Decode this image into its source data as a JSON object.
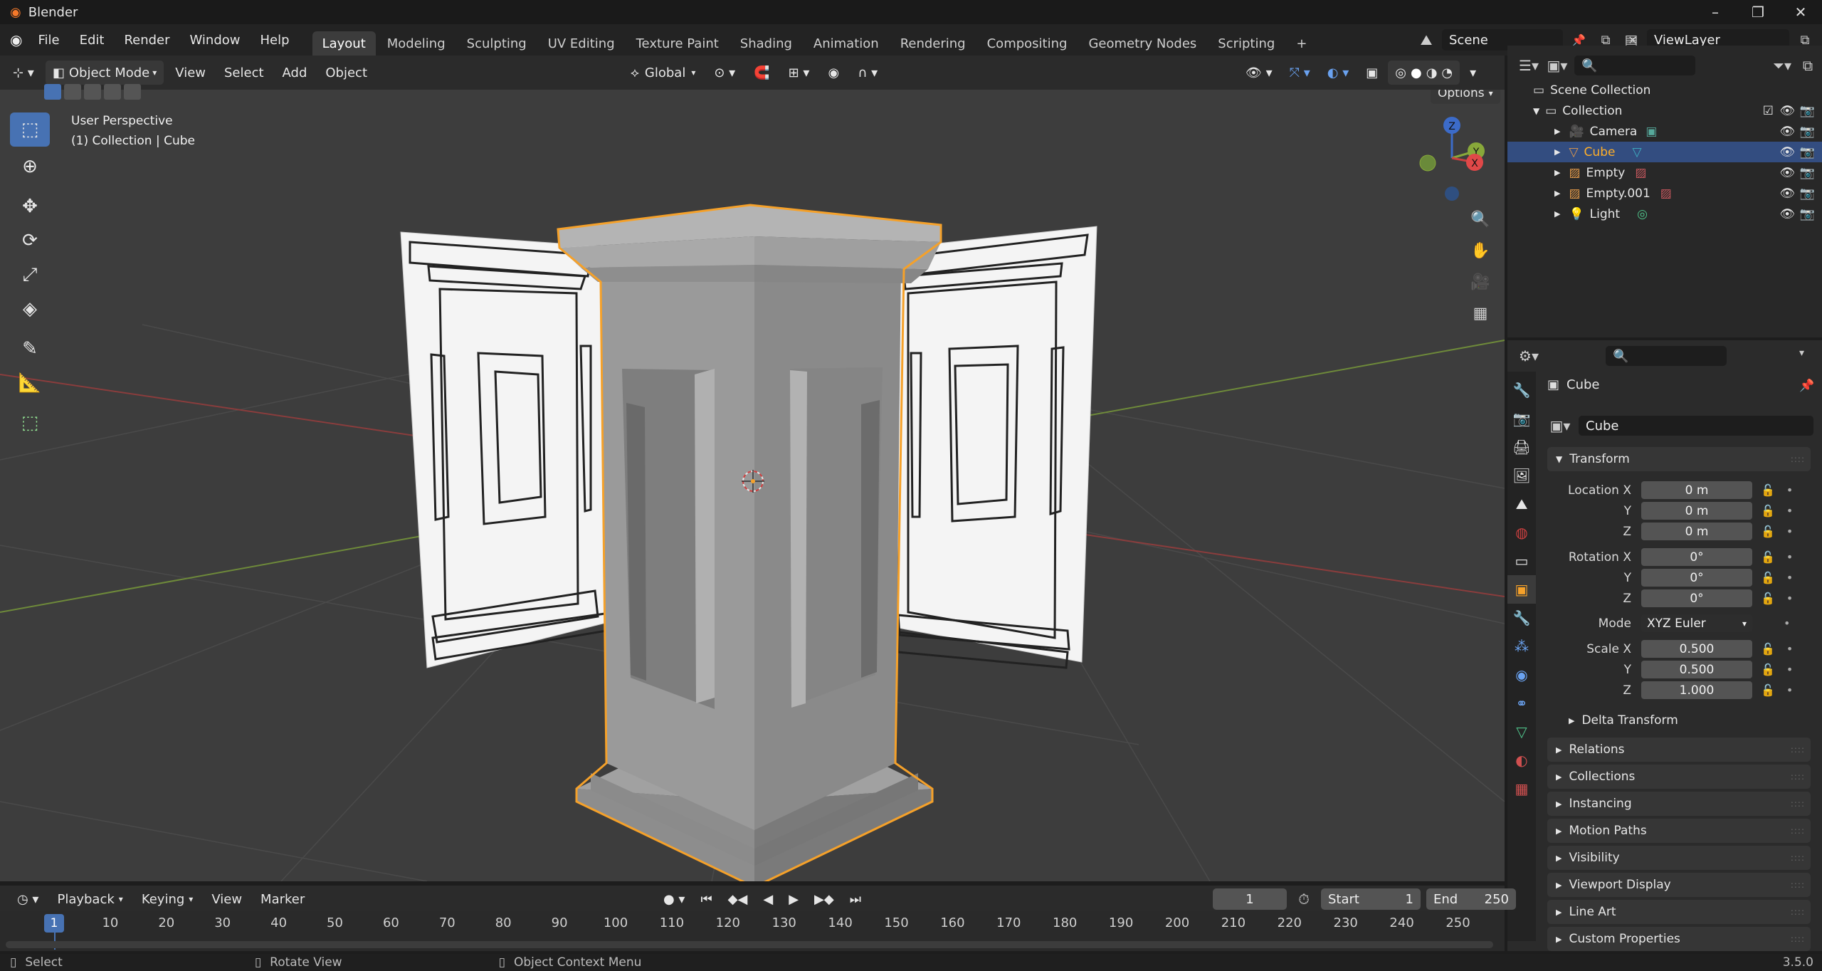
{
  "app": {
    "title": "Blender",
    "version": "3.5.0"
  },
  "window_controls": {
    "minimize": "–",
    "maximize": "❐",
    "close": "✕"
  },
  "menus": [
    "File",
    "Edit",
    "Render",
    "Window",
    "Help"
  ],
  "workspace_tabs": [
    "Layout",
    "Modeling",
    "Sculpting",
    "UV Editing",
    "Texture Paint",
    "Shading",
    "Animation",
    "Rendering",
    "Compositing",
    "Geometry Nodes",
    "Scripting"
  ],
  "workspace_add": "+",
  "scene": {
    "name": "Scene"
  },
  "view_layer": {
    "name": "ViewLayer"
  },
  "viewport_header": {
    "mode": "Object Mode",
    "menus": [
      "View",
      "Select",
      "Add",
      "Object"
    ],
    "orientation": "Global",
    "options": "Options"
  },
  "viewport": {
    "perspective": "User Perspective",
    "collection_info": "(1) Collection | Cube",
    "gizmo": {
      "z": "Z",
      "y": "Y",
      "x": "X"
    }
  },
  "tools": [
    "select-box",
    "cursor",
    "move",
    "rotate",
    "scale",
    "transform",
    "annotate",
    "measure",
    "add-cube"
  ],
  "outliner": {
    "search_placeholder": "",
    "scene_collection": "Scene Collection",
    "collection": "Collection",
    "items": [
      {
        "name": "Camera",
        "icon": "camera-icon",
        "color": "#e39a4a",
        "extra_color": "#56a89a",
        "selected": false
      },
      {
        "name": "Cube",
        "icon": "mesh-icon",
        "color": "#e39a4a",
        "extra_color": "#3fb0c2",
        "selected": true
      },
      {
        "name": "Empty",
        "icon": "empty-image-icon",
        "color": "#e39a4a",
        "extra_color": "#c8585e",
        "selected": false
      },
      {
        "name": "Empty.001",
        "icon": "empty-image-icon",
        "color": "#e39a4a",
        "extra_color": "#c8585e",
        "selected": false
      },
      {
        "name": "Light",
        "icon": "light-icon",
        "color": "#e39a4a",
        "extra_color": "#4fc28a",
        "selected": false
      }
    ]
  },
  "properties": {
    "object_name": "Cube",
    "name_field": "Cube",
    "transform": {
      "title": "Transform",
      "location": {
        "label": "Location X",
        "x": "0 m",
        "y": "0 m",
        "z": "0 m"
      },
      "rotation": {
        "label": "Rotation X",
        "x": "0°",
        "y": "0°",
        "z": "0°"
      },
      "mode_label": "Mode",
      "mode": "XYZ Euler",
      "scale": {
        "label": "Scale X",
        "x": "0.500",
        "y": "0.500",
        "z": "1.000"
      },
      "y_label": "Y",
      "z_label": "Z",
      "delta": "Delta Transform"
    },
    "panels": [
      "Relations",
      "Collections",
      "Instancing",
      "Motion Paths",
      "Visibility",
      "Viewport Display",
      "Line Art",
      "Custom Properties"
    ]
  },
  "timeline": {
    "menus": [
      "Playback",
      "Keying",
      "View",
      "Marker"
    ],
    "current_frame": "1",
    "start_label": "Start",
    "start": "1",
    "end_label": "End",
    "end": "250",
    "ruler": [
      "10",
      "20",
      "30",
      "40",
      "50",
      "60",
      "70",
      "80",
      "90",
      "100",
      "110",
      "120",
      "130",
      "140",
      "150",
      "160",
      "170",
      "180",
      "190",
      "200",
      "210",
      "220",
      "230",
      "240",
      "250"
    ],
    "playhead_label": "1"
  },
  "statusbar": {
    "select": "Select",
    "rotate": "Rotate View",
    "context": "Object Context Menu",
    "version": "3.5.0"
  },
  "colors": {
    "accent": "#4772b3",
    "selection": "#ffa02c",
    "outliner_selected": "#334d80"
  }
}
